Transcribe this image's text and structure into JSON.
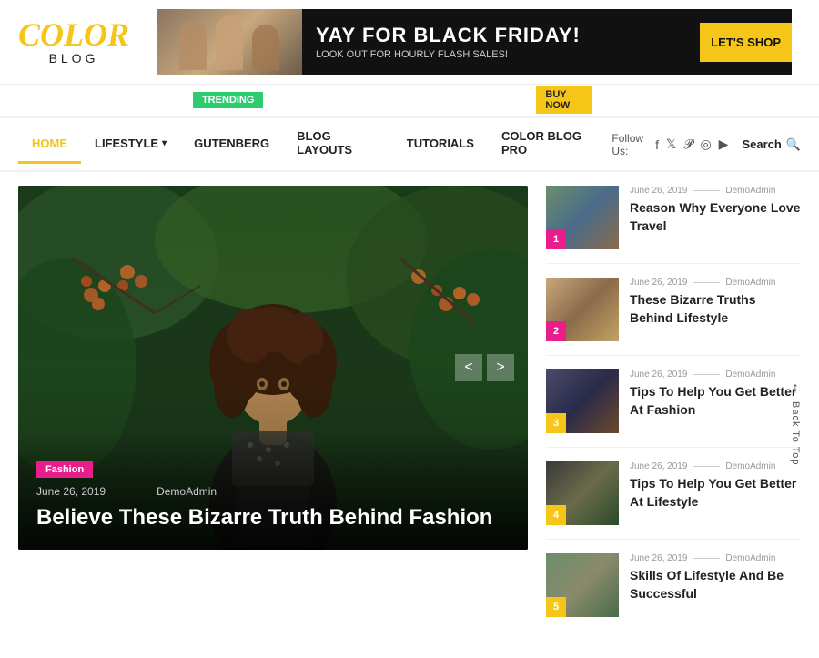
{
  "site": {
    "logo_color": "COLOR",
    "logo_blog": "BLOG",
    "logo_color_highlight": "OL"
  },
  "banner": {
    "title": "YAY FOR BLACK FRIDAY!",
    "subtitle": "LOOK OUT FOR HOURLY FLASH SALES!",
    "button": "LET'S SHOP"
  },
  "trending_badge": "TRENDING",
  "buy_now_badge": "BUY NOW",
  "nav": {
    "items": [
      {
        "label": "HOME",
        "active": true
      },
      {
        "label": "LIFESTYLE",
        "has_dropdown": true
      },
      {
        "label": "GUTENBERG",
        "has_dropdown": false
      },
      {
        "label": "BLOG LAYOUTS",
        "has_dropdown": false
      },
      {
        "label": "TUTORIALS",
        "has_dropdown": false
      },
      {
        "label": "COLOR BLOG PRO",
        "has_dropdown": false
      }
    ],
    "follow_label": "Follow Us:",
    "search_label": "Search"
  },
  "hero": {
    "category": "Fashion",
    "date": "June 26, 2019",
    "author": "DemoAdmin",
    "title": "Believe These Bizarre Truth Behind Fashion",
    "prev": "<",
    "next": ">"
  },
  "sidebar": {
    "items": [
      {
        "number": "1",
        "badge_class": "badge-1",
        "thumb_class": "thumb-1",
        "date": "June 26, 2019",
        "author": "DemoAdmin",
        "title": "Reason Why Everyone Love Travel"
      },
      {
        "number": "2",
        "badge_class": "badge-2",
        "thumb_class": "thumb-2",
        "date": "June 26, 2019",
        "author": "DemoAdmin",
        "title": "These Bizarre Truths Behind Lifestyle"
      },
      {
        "number": "3",
        "badge_class": "badge-3",
        "thumb_class": "thumb-3",
        "date": "June 26, 2019",
        "author": "DemoAdmin",
        "title": "Tips To Help You Get Better At Fashion"
      },
      {
        "number": "4",
        "badge_class": "badge-4",
        "thumb_class": "thumb-4",
        "date": "June 26, 2019",
        "author": "DemoAdmin",
        "title": "Tips To Help You Get Better At Lifestyle"
      },
      {
        "number": "5",
        "badge_class": "badge-5",
        "thumb_class": "thumb-5",
        "date": "June 26, 2019",
        "author": "DemoAdmin",
        "title": "Skills Of Lifestyle And Be Successful"
      }
    ]
  },
  "back_to_top": "Back To Top"
}
